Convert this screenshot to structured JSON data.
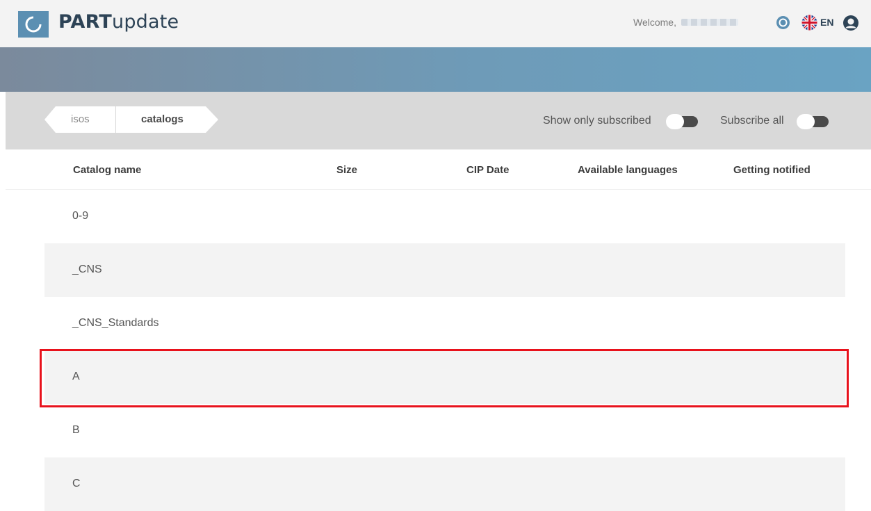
{
  "header": {
    "brand_bold": "PART",
    "brand_rest": "update",
    "welcome": "Welcome,",
    "language": "EN",
    "icons": [
      "logo-icon",
      "support-icon",
      "uk-flag-icon",
      "user-icon"
    ]
  },
  "breadcrumb": [
    {
      "label": "isos"
    },
    {
      "label": "catalogs"
    }
  ],
  "options": {
    "show_only_subscribed": "Show only subscribed",
    "subscribe_all": "Subscribe all"
  },
  "table": {
    "columns": [
      "Catalog name",
      "Size",
      "CIP Date",
      "Available languages",
      "Getting notified"
    ],
    "rows": [
      {
        "name": "0-9"
      },
      {
        "name": "_CNS"
      },
      {
        "name": "_CNS_Standards"
      },
      {
        "name": "A"
      },
      {
        "name": "B"
      },
      {
        "name": "C"
      }
    ]
  },
  "colors": {
    "brand": "#5b8fb2",
    "text_dark": "#2d4356",
    "highlight": "#e8121c",
    "row_alt": "#f3f3f3"
  }
}
